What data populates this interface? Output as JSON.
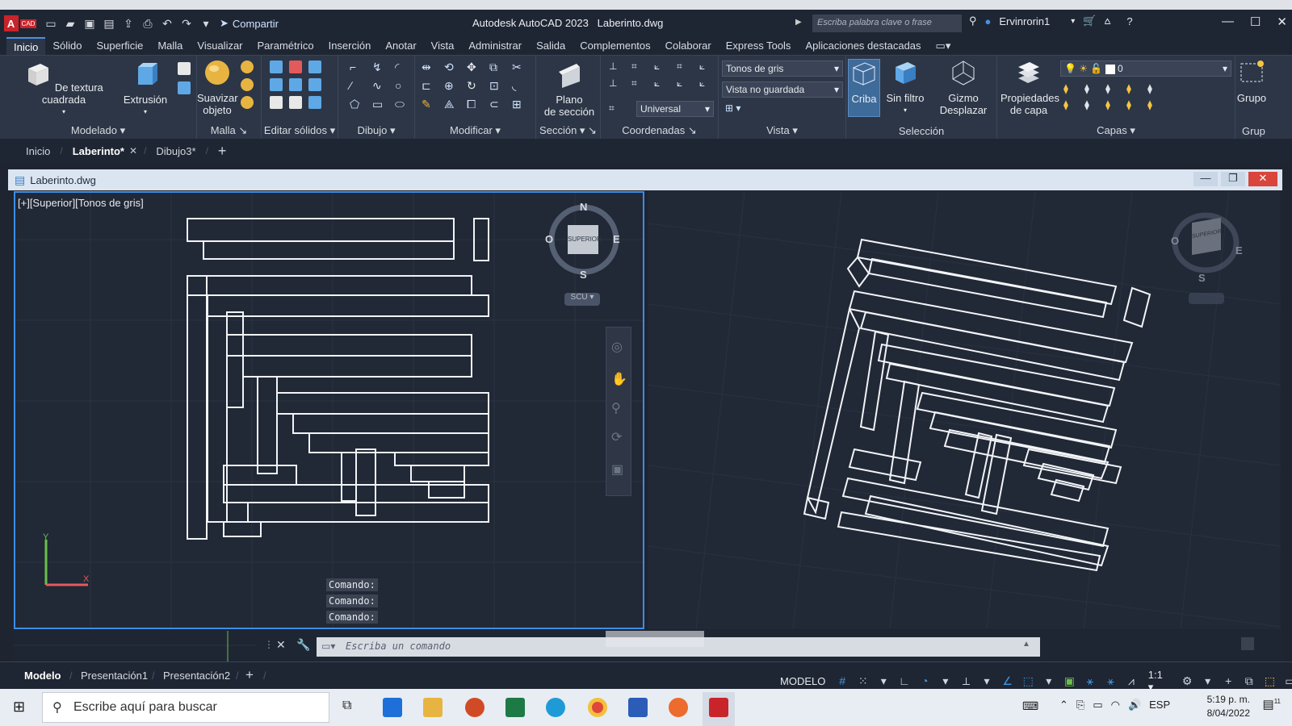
{
  "app": {
    "title": "Autodesk AutoCAD 2023",
    "filename": "Laberinto.dwg",
    "logo_letter": "A",
    "logo_sub": "CAD",
    "share_label": "Compartir",
    "search_placeholder": "Escriba palabra clave o frase",
    "username": "Ervinrorin1"
  },
  "ribbon_tabs": [
    "Inicio",
    "Sólido",
    "Superficie",
    "Malla",
    "Visualizar",
    "Paramétrico",
    "Inserción",
    "Anotar",
    "Vista",
    "Administrar",
    "Salida",
    "Complementos",
    "Colaborar",
    "Express Tools",
    "Aplicaciones destacadas"
  ],
  "ribbon": {
    "modelado": {
      "title": "Modelado",
      "btn1": "De textura cuadrada",
      "btn2": "Extrusión"
    },
    "malla": {
      "title": "Malla",
      "btn1": "Suavizar",
      "btn1b": "objeto"
    },
    "editar_solidos": {
      "title": "Editar sólidos"
    },
    "dibujo": {
      "title": "Dibujo"
    },
    "modificar": {
      "title": "Modificar"
    },
    "seccion": {
      "title": "Sección",
      "btn1": "Plano",
      "btn1b": "de sección"
    },
    "coordenadas": {
      "title": "Coordenadas",
      "ucs": "Universal"
    },
    "vista": {
      "title": "Vista",
      "style": "Tonos de gris",
      "saved": "Vista no guardada"
    },
    "seleccion": {
      "title": "Selección",
      "btn1": "Criba",
      "btn2": "Sin filtro",
      "btn3": "Gizmo",
      "btn3b": "Desplazar"
    },
    "capas": {
      "title": "Capas",
      "btn1": "Propiedades",
      "btn1b": "de capa",
      "layer": "0"
    },
    "grupos": {
      "title": "Grup",
      "btn": "Grupo"
    }
  },
  "doc_tabs": {
    "home": "Inicio",
    "active": "Laberinto*",
    "other": "Dibujo3*"
  },
  "doc_window_title": "Laberinto.dwg",
  "viewport_left": {
    "label": "[+][Superior][Tonos de gris]",
    "compass": {
      "n": "N",
      "s": "S",
      "e": "E",
      "w": "O",
      "face": "SUPERIOR",
      "ucs": "SCU"
    }
  },
  "viewport_right": {
    "compass": {
      "e": "E",
      "w": "O",
      "s": "S",
      "face": "SUPERIOR"
    }
  },
  "command": {
    "history": [
      "Comando:",
      "Comando:",
      "Comando:"
    ],
    "placeholder": "Escriba un comando"
  },
  "layout_tabs": [
    "Modelo",
    "Presentación1",
    "Presentación2"
  ],
  "status": {
    "model": "MODELO",
    "scale": "1:1"
  },
  "taskbar": {
    "search": "Escribe aquí para buscar",
    "lang": "ESP",
    "time": "5:19 p. m.",
    "date": "8/04/2022",
    "notif": "11"
  },
  "colors": {
    "accent": "#3c8ee6",
    "bg": "#212836",
    "ribbon": "#2d3646"
  }
}
